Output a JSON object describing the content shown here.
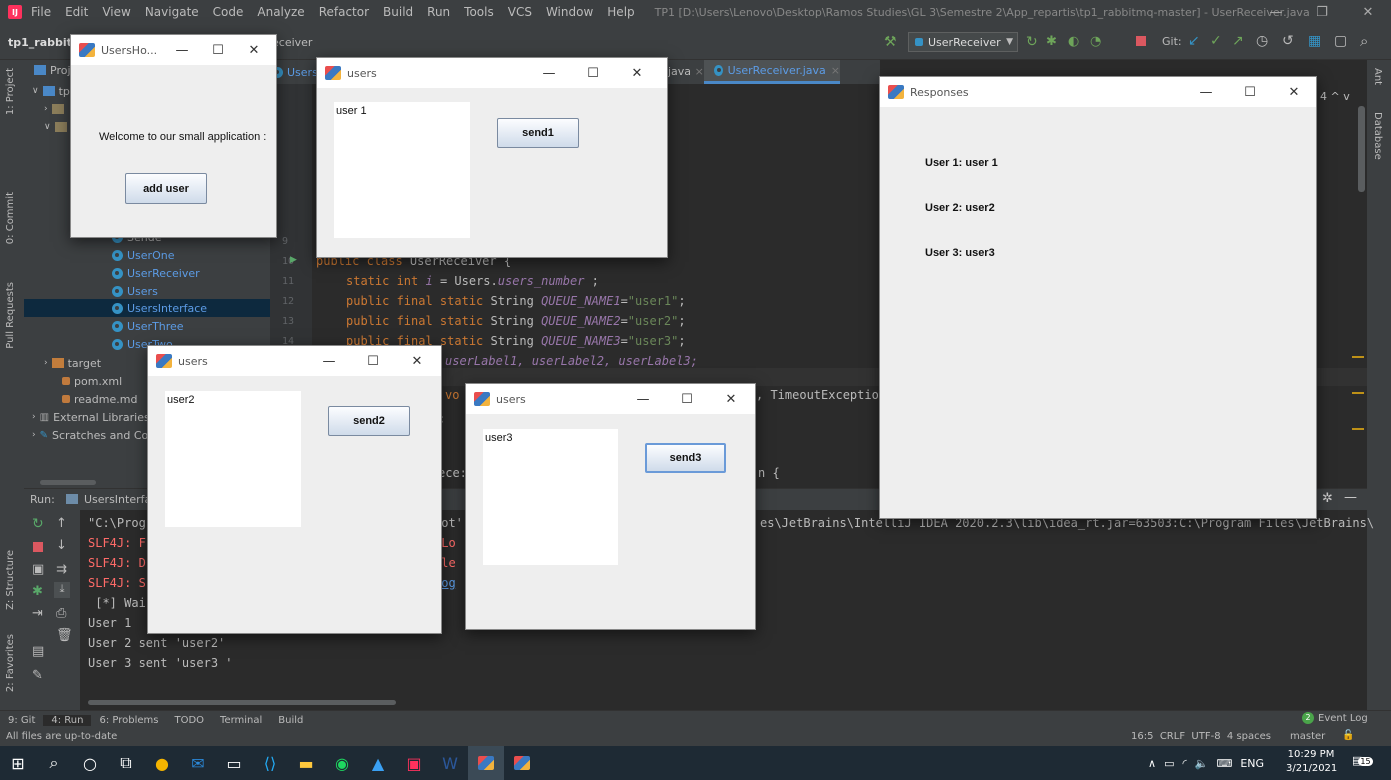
{
  "menu": {
    "items": [
      "File",
      "Edit",
      "View",
      "Navigate",
      "Code",
      "Analyze",
      "Refactor",
      "Build",
      "Run",
      "Tools",
      "VCS",
      "Window",
      "Help"
    ],
    "title": "TP1 [D:\\Users\\Lenovo\\Desktop\\Ramos Studies\\GL 3\\Semestre 2\\App_repartis\\tp1_rabbitmq-master] - UserReceiver.java"
  },
  "nav": {
    "project": "tp1_rabbit",
    "crumb": "eceiver",
    "run_config": "UserReceiver",
    "git_label": "Git:"
  },
  "sidebar_left": [
    "1: Project",
    "0: Commit",
    "Pull Requests",
    "Z: Structure",
    "2: Favorites"
  ],
  "sidebar_right": [
    "Ant",
    "Database"
  ],
  "project_panel": {
    "header": "Proj",
    "items": [
      "tp",
      "",
      "",
      "Sende",
      "UserOne",
      "UserReceiver",
      "Users",
      "UsersInterface",
      "UserThree",
      "UserTwo",
      "target",
      "pom.xml",
      "readme.md",
      "External Libraries",
      "Scratches and Co"
    ]
  },
  "editor": {
    "tabs": [
      "Users.",
      "java",
      "UserReceiver.java"
    ],
    "line_numbers": [
      "9",
      "10",
      "11",
      "12",
      "13",
      "14"
    ],
    "code": [
      {
        "kw": "public class ",
        "txt": "UserReceiver {"
      },
      {
        "kw": "static int ",
        "it": "i",
        "txt": " = Users.",
        "fld": "users_number",
        "txt2": " ;"
      },
      {
        "kw": "public final static ",
        "txt": "String ",
        "fld": "QUEUE_NAME1",
        "txt2": "=",
        "str": "\"user1\"",
        "txt3": ";"
      },
      {
        "kw": "public final static ",
        "txt": "String ",
        "fld": "QUEUE_NAME2",
        "txt2": "=",
        "str": "\"user2\"",
        "txt3": ";"
      },
      {
        "kw": "public final static ",
        "txt": "String ",
        "fld": "QUEUE_NAME3",
        "txt2": "=",
        "str": "\"user3\"",
        "txt3": ";"
      }
    ],
    "frag_labels": "userLabel1, userLabel2, userLabel3;",
    "frag_vo": "vo",
    "frag_timeout": ", TimeoutException",
    "frag_semi": ";",
    "frag_ece": "ece:",
    "frag_n": "n {",
    "line_tail": "4 ^ v"
  },
  "run": {
    "label": "Run:",
    "tab": "UsersInterfac",
    "lines": [
      {
        "text": "\"C:\\Prog",
        "color": "#bbbbbb"
      },
      {
        "text": "SLF4J: F",
        "color": "#ff6b68"
      },
      {
        "text": "SLF4J: D",
        "color": "#ff6b68"
      },
      {
        "text": "SLF4J: S",
        "color": "#ff6b68"
      },
      {
        "text": " [*] Wai",
        "color": "#bbbbbb"
      },
      {
        "text": "User 1 ",
        "color": "#bbbbbb"
      },
      {
        "text": "User 2 sent 'user2'",
        "color": "#bbbbbb"
      },
      {
        "text": "User 3 sent 'user3 '",
        "color": "#bbbbbb"
      }
    ],
    "frag_tail": "es\\JetBrains\\IntelliJ IDEA 2020.2.3\\lib\\idea_rt.jar=63503:C:\\Program Files\\JetBrains\\",
    "frag_pot": "pot'",
    "frag_clo": "cLo",
    "frag_ple": "ple",
    "frag_log": "Log"
  },
  "bottom_tools": [
    "9: Git",
    "4: Run",
    "6: Problems",
    "TODO",
    "Terminal",
    "Build"
  ],
  "event_log": "Event Log",
  "event_count": "2",
  "status": {
    "left": "All files are up-to-date",
    "right": "16:5  CRLF  UTF-8  4 spaces",
    "branch": "master"
  },
  "taskbar": {
    "time": "10:29 PM",
    "date": "3/21/2021",
    "lang": "ENG",
    "notif": "15"
  },
  "win_home": {
    "title": "UsersHo...",
    "welcome": "Welcome to our small application :",
    "button": "add user"
  },
  "win_users1": {
    "title": "users",
    "text": "user 1",
    "button": "send1"
  },
  "win_users2": {
    "title": "users",
    "text": "user2",
    "button": "send2"
  },
  "win_users3": {
    "title": "users",
    "text": "user3",
    "button": "send3"
  },
  "win_responses": {
    "title": "Responses",
    "lines": [
      "User 1: user 1",
      "User 2: user2",
      "User 3: user3"
    ]
  },
  "colors": {
    "accent": "#3592c4",
    "keyword": "#cc7832",
    "string": "#6a8759",
    "field": "#9876aa",
    "error": "#ff6b68"
  }
}
